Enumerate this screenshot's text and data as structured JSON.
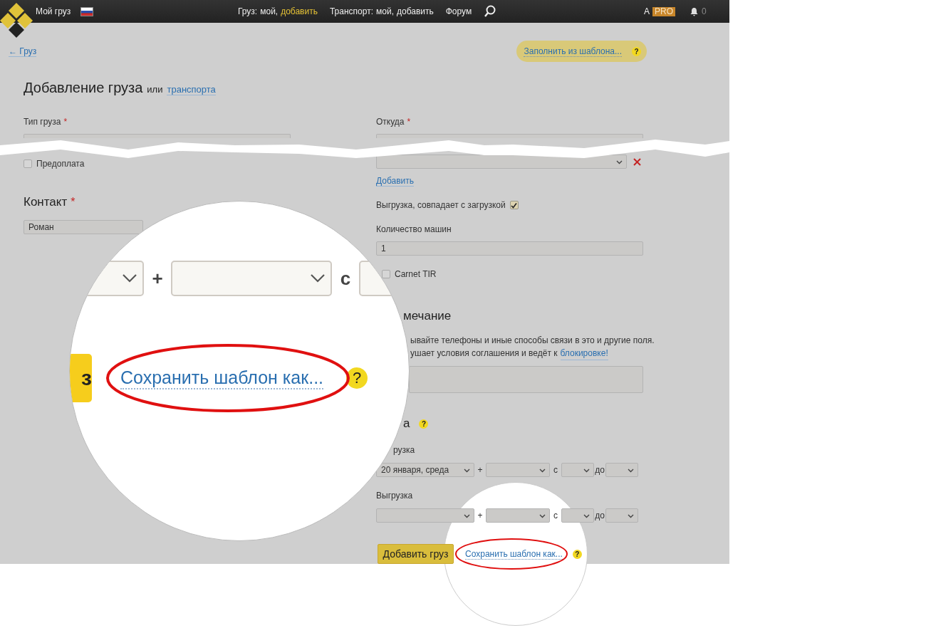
{
  "header": {
    "account": "Мой груз",
    "nav": [
      {
        "prefix": "Груз:",
        "links": [
          {
            "label": "мой,",
            "selected": false
          },
          {
            "label": "добавить",
            "selected": true
          }
        ]
      },
      {
        "prefix": "Транспорт:",
        "links": [
          {
            "label": "мой,",
            "selected": false
          },
          {
            "label": "добавить",
            "selected": false
          }
        ]
      },
      {
        "prefix": "Форум"
      }
    ],
    "user": "A",
    "badge": "PRO",
    "notifications": "0"
  },
  "back_link": "← Груз",
  "template_button": {
    "label": "Заполнить из шаблона...",
    "help": "?"
  },
  "title": {
    "main": "Добавление груза",
    "connector": "или",
    "link": "транспорта"
  },
  "left": {
    "cargo_type_label": "Тип груза",
    "required": "*",
    "prepayment": {
      "label": "Предоплата",
      "checked": false
    },
    "contact_heading": "Контакт",
    "contact_required": "*",
    "contact_value": "Роман"
  },
  "right": {
    "from_label": "Откуда",
    "from_required": "*",
    "add_link": "Добавить",
    "same_unload": {
      "label": "Выгрузка, совпадает с загрузкой",
      "checked": true
    },
    "trucks_label": "Количество машин",
    "trucks_value": "1",
    "carnet": {
      "label": "Carnet TIR",
      "checked": false
    },
    "note_heading": "мечание",
    "warning_line": "ывайте телефоны и иные способы связи в это и другие поля.",
    "warning_line_2": {
      "text": "ушает условия соглашения и ведёт к",
      "link": "блокировке!"
    },
    "date_heading": "а",
    "date_help": "?",
    "loading": {
      "label": "рузка",
      "date": "20 января, среда",
      "plus": "+",
      "from": "с",
      "to": "до"
    },
    "unloading": {
      "label": "Выгрузка",
      "plus": "+",
      "from": "с",
      "to": "до"
    }
  },
  "submit": "Добавить груз",
  "save_template": "Сохранить шаблон как...",
  "save_help": "?",
  "magnifier": {
    "plus": "+",
    "from": "с",
    "button_fragment": "з",
    "link": "Сохранить шаблон как...",
    "help": "?"
  }
}
